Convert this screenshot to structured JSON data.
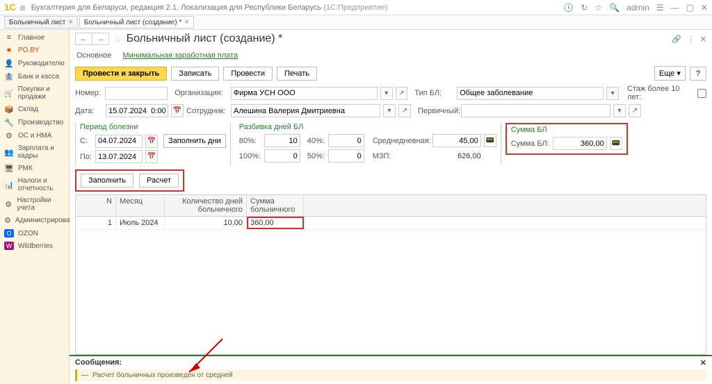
{
  "header": {
    "app_title": "Бухгалтерия для Беларуси, редакция 2.1. Локализация для Республики Беларусь",
    "app_subtitle": "(1С:Предприятие)",
    "user": "admin"
  },
  "tabs": [
    {
      "label": "Больничный лист"
    },
    {
      "label": "Больничный лист (создание) *"
    }
  ],
  "sidebar": [
    {
      "label": "Главное",
      "icon": "≡"
    },
    {
      "label": "PO.BY",
      "icon": "✷"
    },
    {
      "label": "Руководителю",
      "icon": "👤"
    },
    {
      "label": "Банк и касса",
      "icon": "🏦"
    },
    {
      "label": "Покупки и продажи",
      "icon": "🛒"
    },
    {
      "label": "Склад",
      "icon": "📦"
    },
    {
      "label": "Производство",
      "icon": "🔧"
    },
    {
      "label": "ОС и НМА",
      "icon": "⚙"
    },
    {
      "label": "Зарплата и кадры",
      "icon": "👥"
    },
    {
      "label": "РМК",
      "icon": "🖥"
    },
    {
      "label": "Налоги и отчетность",
      "icon": "📊"
    },
    {
      "label": "Настройки учета",
      "icon": "⚙"
    },
    {
      "label": "Администрирование",
      "icon": "⚙"
    },
    {
      "label": "OZON",
      "icon": "O"
    },
    {
      "label": "Wildberries",
      "icon": "W"
    }
  ],
  "page": {
    "title": "Больничный лист (создание) *",
    "subtabs": {
      "main": "Основное",
      "minwage": "Минимальная заработная плата"
    },
    "toolbar": {
      "post_close": "Провести и закрыть",
      "write": "Записать",
      "post": "Провести",
      "print": "Печать",
      "more": "Еще",
      "help": "?"
    }
  },
  "fields": {
    "number_lbl": "Номер:",
    "number_val": "",
    "date_lbl": "Дата:",
    "date_val": "15.07.2024  0:00:00",
    "org_lbl": "Организация:",
    "org_val": "Фирма УСН ООО",
    "emp_lbl": "Сотрудник:",
    "emp_val": "Алешина Валерия Дмитриевна",
    "type_lbl": "Тип БЛ:",
    "type_val": "Общее заболевание",
    "primary_lbl": "Первичный:",
    "primary_val": "",
    "over10_lbl": "Стаж более 10 лет:"
  },
  "period": {
    "title": "Период болезни",
    "from_lbl": "С:",
    "from_val": "04.07.2024",
    "to_lbl": "По:",
    "to_val": "13.07.2024",
    "fill_days": "Заполнить дни"
  },
  "breakdown": {
    "title": "Разбивка дней БЛ",
    "p80_lbl": "80%:",
    "p80_val": "10",
    "p100_lbl": "100%:",
    "p100_val": "0",
    "p40_lbl": "40%:",
    "p40_val": "0",
    "p50_lbl": "50%:",
    "p50_val": "0",
    "avg_lbl": "Среднедневная:",
    "avg_val": "45,00",
    "mzp_lbl": "МЗП:",
    "mzp_val": "626,00"
  },
  "sum": {
    "title": "Сумма БЛ",
    "lbl": "Сумма БЛ:",
    "val": "360,00"
  },
  "actions": {
    "fill": "Заполнить",
    "calc": "Расчет"
  },
  "table": {
    "headers": {
      "n": "N",
      "month": "Месяц",
      "days": "Количество дней больничного",
      "sum": "Сумма больничного"
    },
    "rows": [
      {
        "n": "1",
        "month": "Июль 2024",
        "days": "10,00",
        "sum": "360,00"
      }
    ]
  },
  "messages": {
    "title": "Сообщения:",
    "items": [
      "Расчет больничных произведен от средней"
    ]
  }
}
